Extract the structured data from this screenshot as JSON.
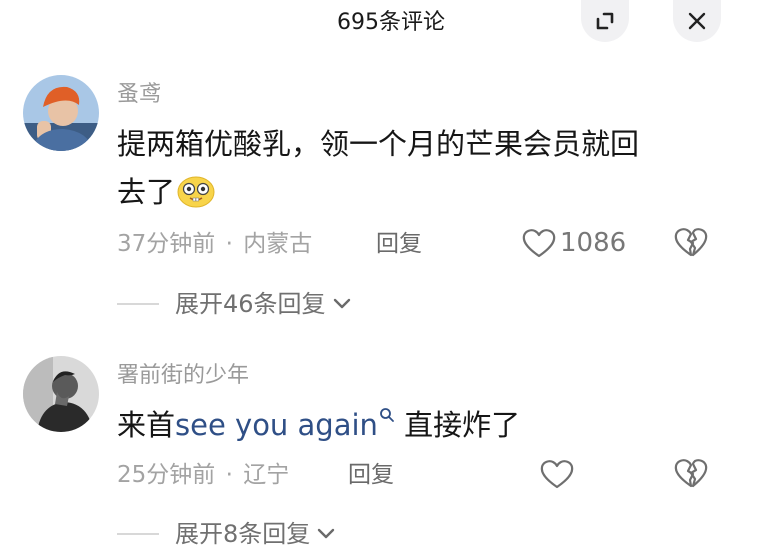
{
  "header": {
    "title": "695条评论"
  },
  "comments": [
    {
      "username": "蚤鸢",
      "text_line1": "提两箱优酸乳，领一个月的芒果会员就回",
      "text_line2": "去了",
      "time": "37分钟前",
      "separator": "·",
      "location": "内蒙古",
      "reply_label": "回复",
      "like_count": "1086",
      "expand_label": "展开46条回复"
    },
    {
      "username": "署前街的少年",
      "text_prefix": "来首",
      "link_text": "see you again",
      "text_suffix": " 直接炸了",
      "time": "25分钟前",
      "separator": "·",
      "location": "辽宁",
      "reply_label": "回复",
      "expand_label": "展开8条回复"
    }
  ],
  "icons": {
    "expand": "expand-icon",
    "close": "close-icon",
    "like": "heart-icon",
    "dislike": "broken-heart-icon",
    "search": "search-icon",
    "emoji": "emoji-face-icon",
    "chevron": "chevron-down-icon"
  },
  "colors": {
    "link": "#2f4f86",
    "meta": "#a3a3a3",
    "username": "#9a9a9a"
  }
}
